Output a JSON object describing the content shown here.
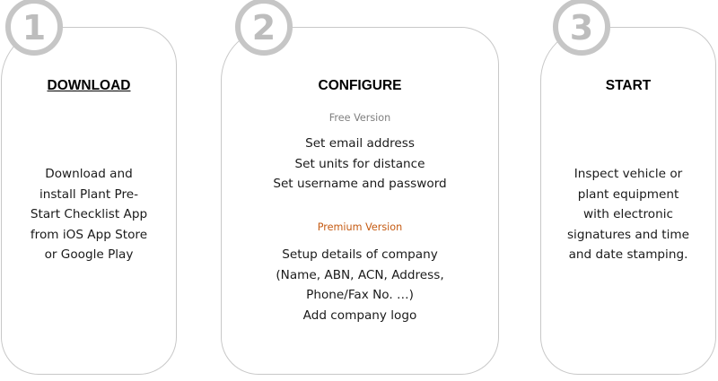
{
  "steps": [
    {
      "number": "1",
      "title": "DOWNLOAD",
      "lines": [
        "Download and",
        "install Plant Pre-",
        "Start Checklist App",
        "from iOS App Store",
        "or Google Play"
      ]
    },
    {
      "number": "2",
      "title": "CONFIGURE",
      "free_label": "Free Version",
      "free_lines": [
        "Set email address",
        "Set units for distance",
        "Set username and password"
      ],
      "premium_label": "Premium Version",
      "premium_lines": [
        "Setup details of company",
        "(Name, ABN, ACN, Address,",
        "Phone/Fax No. …)",
        "Add company logo"
      ]
    },
    {
      "number": "3",
      "title": "START",
      "lines": [
        "Inspect vehicle or",
        "plant equipment",
        "with electronic",
        "signatures and time",
        "and date stamping."
      ]
    }
  ],
  "colors": {
    "badge_ring": "#c6c6c6",
    "badge_digit": "#bdbdbd",
    "card_border": "#c8c8c8",
    "free_label": "#7f7f7f",
    "premium_label": "#c55a11"
  }
}
